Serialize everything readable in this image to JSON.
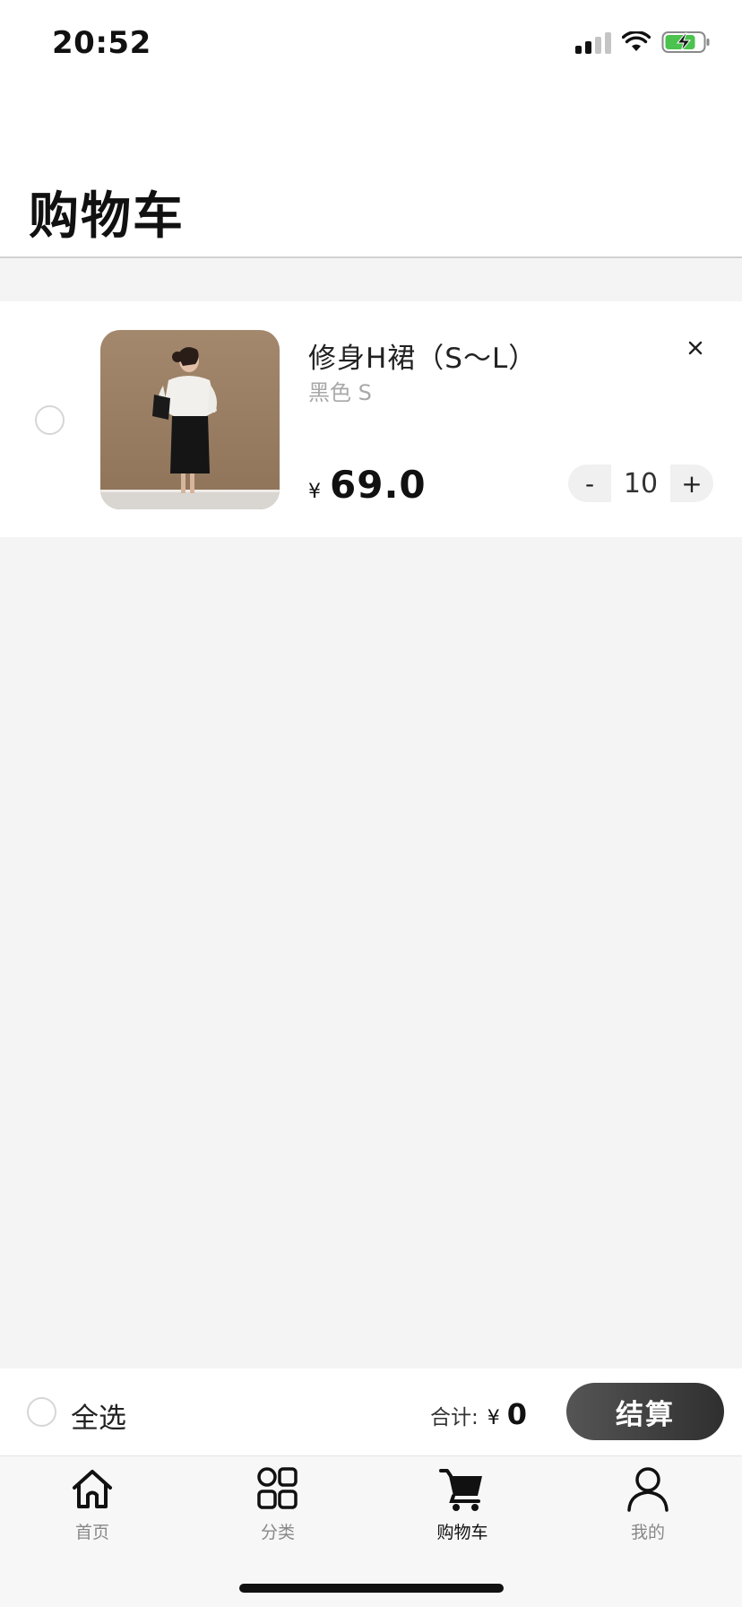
{
  "status_bar": {
    "time": "20:52"
  },
  "header": {
    "title": "购物车"
  },
  "cart": {
    "items": [
      {
        "name": "修身H裙（S～L）",
        "spec": "黑色 S",
        "currency": "¥",
        "price": "69.0",
        "quantity": "10",
        "minus_label": "-",
        "plus_label": "+",
        "checked": false
      }
    ]
  },
  "checkout": {
    "select_all_label": "全选",
    "total_label": "合计:",
    "currency": "¥",
    "total_value": "0",
    "button_label": "结算"
  },
  "tabbar": {
    "tabs": [
      {
        "label": "首页",
        "icon": "home-icon",
        "active": false
      },
      {
        "label": "分类",
        "icon": "grid-icon",
        "active": false
      },
      {
        "label": "购物车",
        "icon": "cart-icon",
        "active": true
      },
      {
        "label": "我的",
        "icon": "user-icon",
        "active": false
      }
    ]
  },
  "colors": {
    "accent": "#333333",
    "background": "#f4f4f4",
    "muted_text": "#a8a8a8"
  }
}
